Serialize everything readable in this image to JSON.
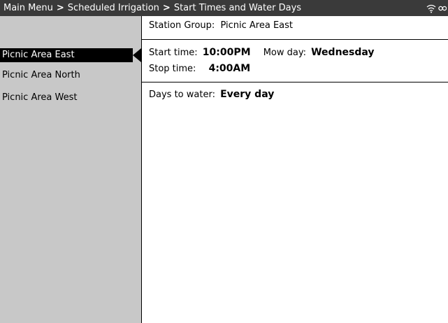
{
  "breadcrumb": {
    "items": [
      "Main Menu",
      "Scheduled Irrigation",
      "Start Times and Water Days"
    ],
    "separator": ">"
  },
  "status_icons": [
    "wifi-icon",
    "link-icon"
  ],
  "sidebar": {
    "items": [
      {
        "label": "Picnic Area East",
        "selected": true
      },
      {
        "label": "Picnic Area North",
        "selected": false
      },
      {
        "label": "Picnic Area West",
        "selected": false
      }
    ]
  },
  "main": {
    "station_group_label": "Station Group:",
    "station_group_value": "Picnic Area East",
    "start_time_label": "Start time:",
    "start_time_value": "10:00PM",
    "mow_day_label": "Mow day:",
    "mow_day_value": "Wednesday",
    "stop_time_label": "Stop time:",
    "stop_time_value": "4:00AM",
    "days_to_water_label": "Days to water:",
    "days_to_water_value": "Every day"
  },
  "colors": {
    "titlebar_bg": "#3a3a3a",
    "sidebar_bg": "#c8c8c8",
    "selected_bg": "#000000",
    "selected_fg": "#ffffff"
  }
}
